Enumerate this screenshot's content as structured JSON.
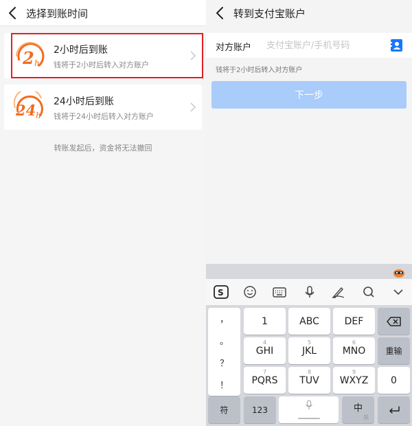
{
  "left": {
    "title": "选择到账时间",
    "options": [
      {
        "badge": "2",
        "badge_suffix": "h",
        "title": "2小时后到账",
        "subtitle": "钱将于2小时后转入对方账户"
      },
      {
        "badge": "24",
        "badge_suffix": "h",
        "title": "24小时后到账",
        "subtitle": "钱将于24小时后转入对方账户"
      }
    ],
    "note": "转账发起后，资金将无法撤回"
  },
  "right": {
    "title": "转到支付宝账户",
    "account_label": "对方账户",
    "account_placeholder": "支付宝账户/手机号码",
    "account_value": "",
    "hint": "钱将于2小时后转入对方账户",
    "next_label": "下一步"
  },
  "keyboard": {
    "toolbar": [
      "sogou-icon",
      "emoji-icon",
      "keyboard-icon",
      "microphone-icon",
      "handwriting-icon",
      "search-icon",
      "chevron-down-icon"
    ],
    "punctuation": [
      "，",
      "。",
      "？",
      "！"
    ],
    "row1": [
      {
        "main": "1",
        "sub": ""
      },
      {
        "main": "ABC",
        "sub": "2"
      },
      {
        "main": "DEF",
        "sub": "3"
      }
    ],
    "row2": [
      {
        "main": "GHI",
        "sub": "4"
      },
      {
        "main": "JKL",
        "sub": "5"
      },
      {
        "main": "MNO",
        "sub": "6"
      }
    ],
    "row3": [
      {
        "main": "PQRS",
        "sub": "7"
      },
      {
        "main": "TUV",
        "sub": "8"
      },
      {
        "main": "WXYZ",
        "sub": "9"
      }
    ],
    "enter_label": "重输",
    "zero_label": "0",
    "symbols_label": "符",
    "numbers_label": "123",
    "lang_label": "中",
    "lang_sub": "英"
  },
  "colors": {
    "accent": "#1677ff",
    "badge": "#f26b1d",
    "highlight": "#e31e24",
    "button_disabled": "#a9ccfa"
  }
}
